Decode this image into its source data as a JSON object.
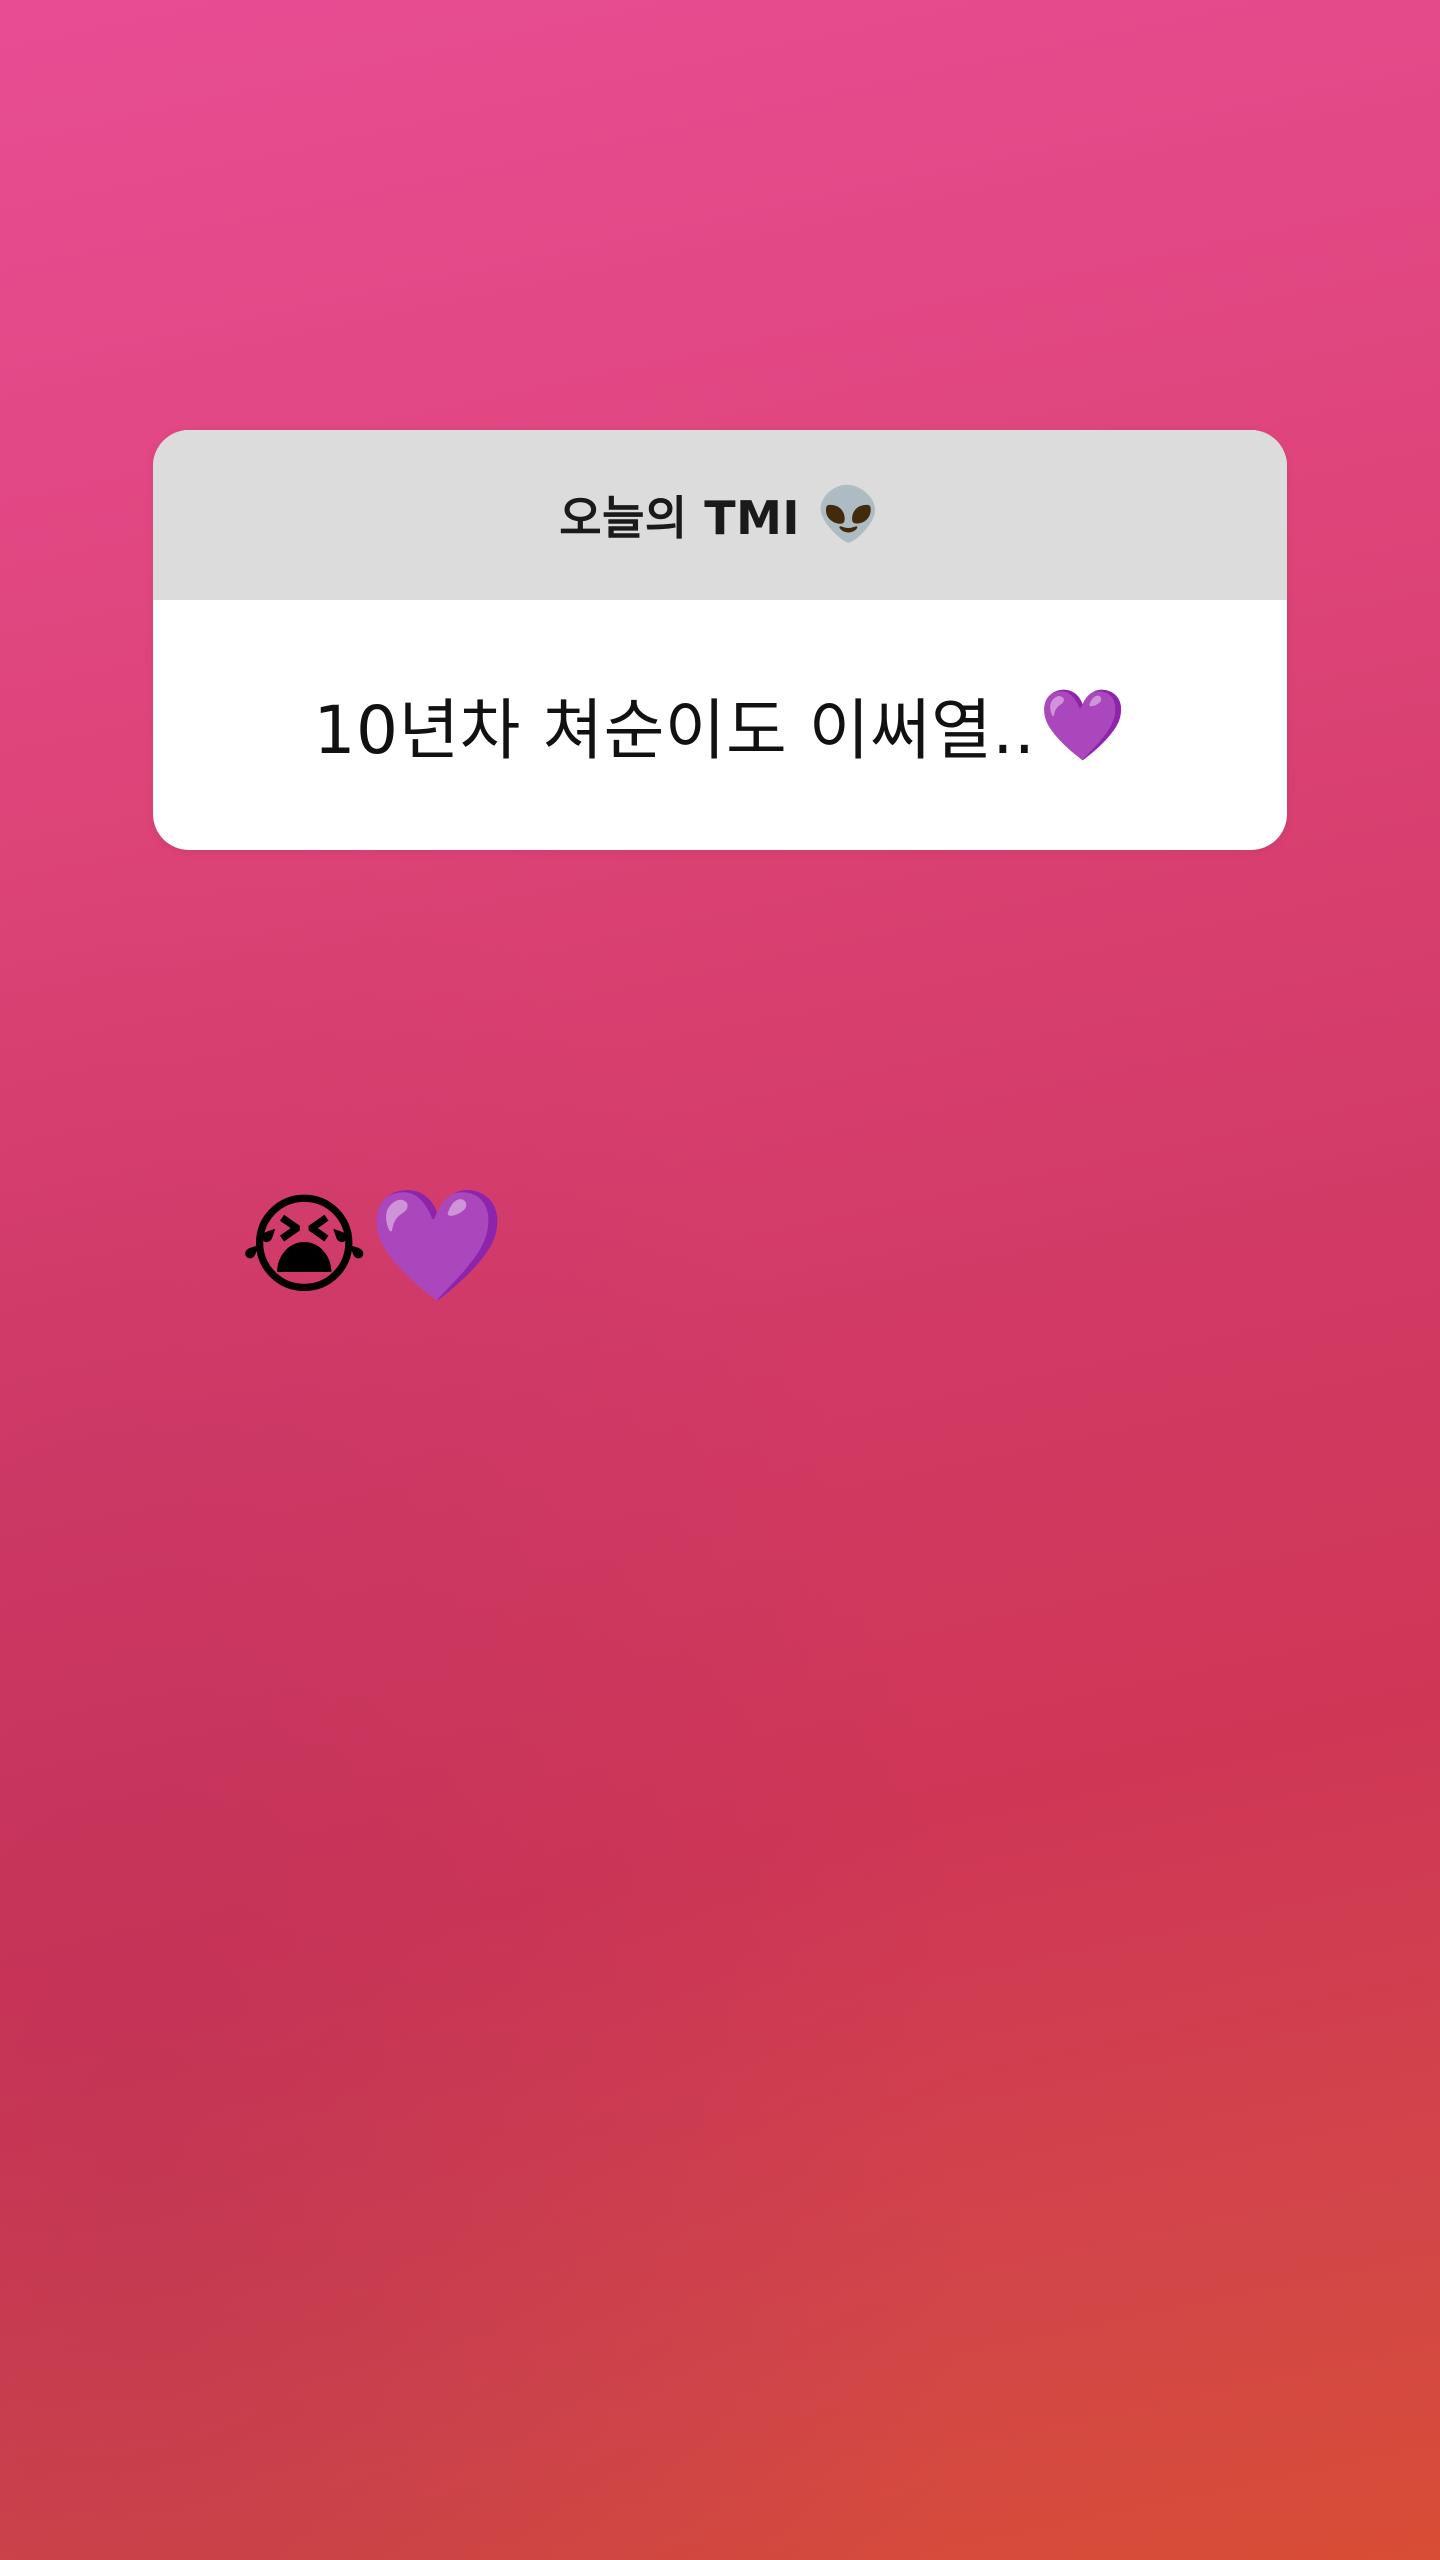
{
  "story": {
    "question_sticker": {
      "title": "오늘의 TMI",
      "title_emoji": "👽",
      "answer": "10년차 쳐순이도 이써열..",
      "answer_emoji": "💜"
    },
    "caption": "😭💜"
  },
  "colors": {
    "gradient_top": "#e84d94",
    "gradient_middle": "#d23a66",
    "gradient_bottom": "#d84d35",
    "sticker_header": "#dcdcdc",
    "sticker_body": "#ffffff",
    "text": "#111111"
  },
  "icons": {
    "title_emoji": "alien-face-icon",
    "answer_emoji": "purple-heart-icon"
  }
}
